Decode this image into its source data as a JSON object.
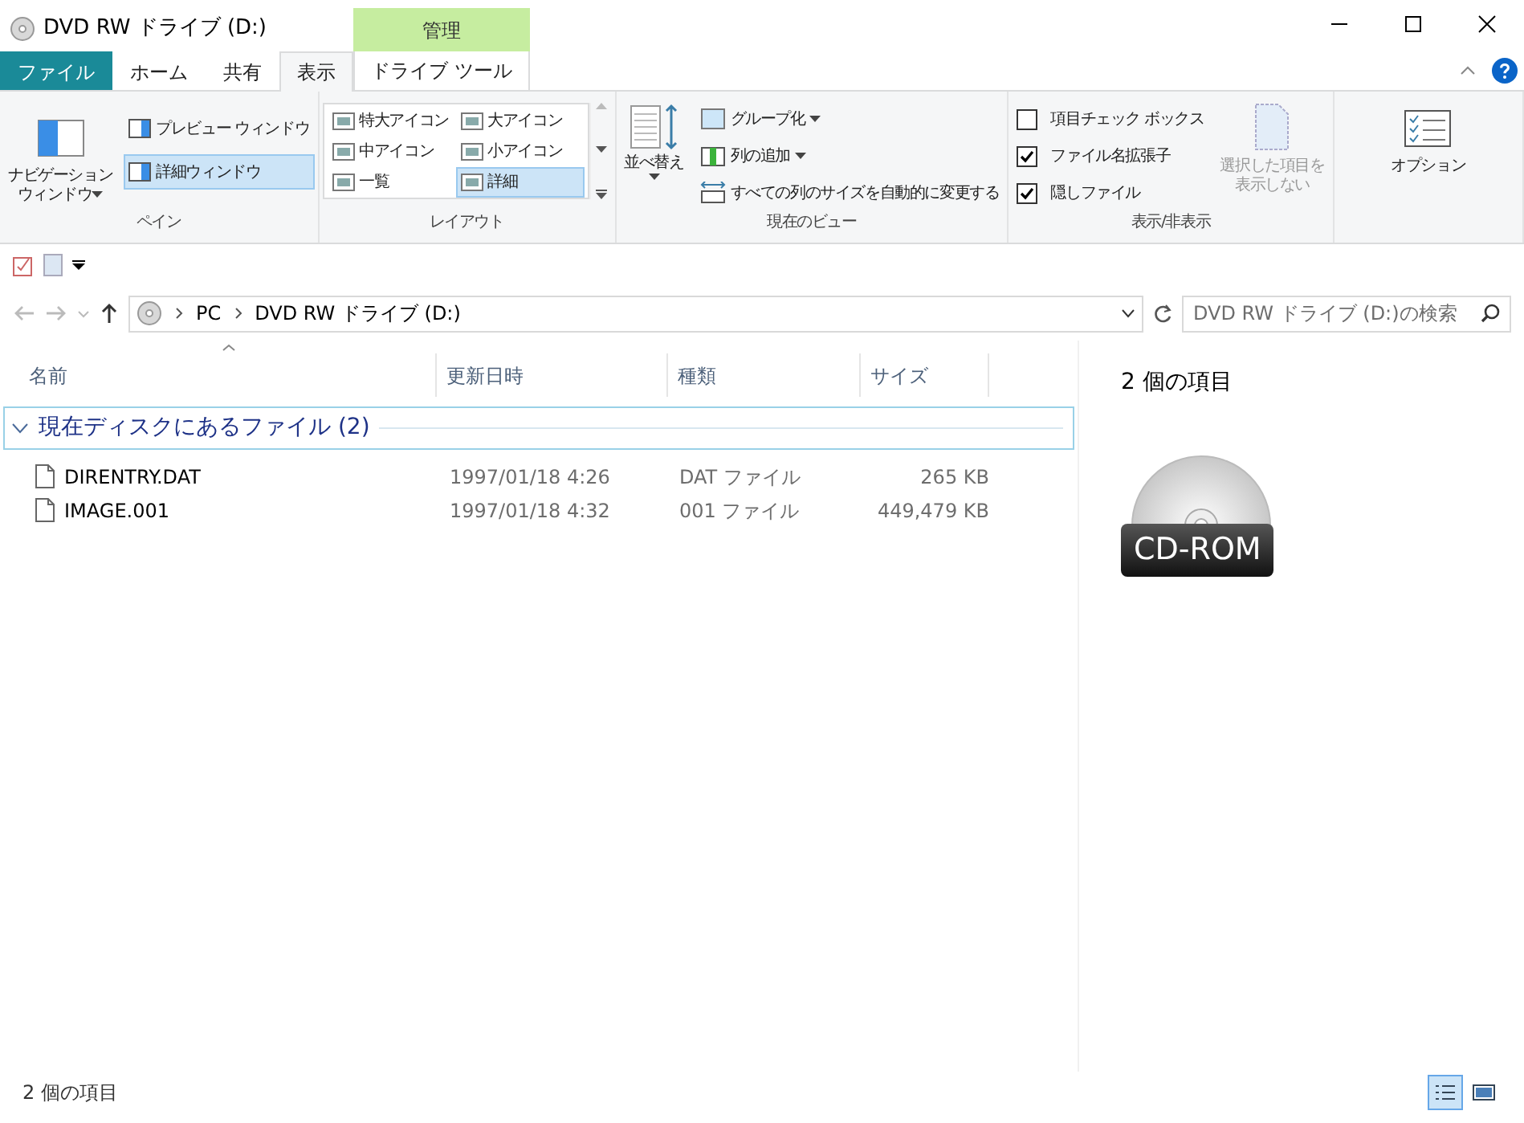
{
  "window": {
    "title": "DVD RW ドライブ (D:)"
  },
  "ribbon": {
    "context_header": "管理",
    "tabs": [
      {
        "label": "ファイル",
        "kind": "file",
        "selected": false
      },
      {
        "label": "ホーム",
        "kind": "normal",
        "selected": false
      },
      {
        "label": "共有",
        "kind": "normal",
        "selected": false
      },
      {
        "label": "表示",
        "kind": "normal",
        "selected": true
      },
      {
        "label": "ドライブ ツール",
        "kind": "context",
        "selected": false
      }
    ],
    "pane": {
      "label": "ペイン",
      "nav_button": {
        "lines": [
          "ナビゲーション",
          "ウィンドウ"
        ]
      },
      "toggles": [
        {
          "label": "プレビュー ウィンドウ",
          "selected": false
        },
        {
          "label": "詳細ウィンドウ",
          "selected": true
        }
      ]
    },
    "layout": {
      "label": "レイアウト",
      "options": [
        {
          "label": "特大アイコン",
          "selected": false
        },
        {
          "label": "大アイコン",
          "selected": false
        },
        {
          "label": "中アイコン",
          "selected": false
        },
        {
          "label": "小アイコン",
          "selected": false
        },
        {
          "label": "一覧",
          "selected": false
        },
        {
          "label": "詳細",
          "selected": true
        }
      ]
    },
    "current_view": {
      "label": "現在のビュー",
      "sort": {
        "label": "並べ替え"
      },
      "items": [
        {
          "label": "グループ化",
          "dropdown": true
        },
        {
          "label": "列の追加",
          "dropdown": true
        },
        {
          "label": "すべての列のサイズを自動的に変更する",
          "dropdown": false
        }
      ]
    },
    "show_hide": {
      "label": "表示/非表示",
      "checkboxes": [
        {
          "label": "項目チェック ボックス",
          "checked": false
        },
        {
          "label": "ファイル名拡張子",
          "checked": true
        },
        {
          "label": "隠しファイル",
          "checked": true
        }
      ],
      "hide_selected": {
        "lines": [
          "選択した項目を",
          "表示しない"
        ],
        "disabled": true
      }
    },
    "options_button": {
      "label": "オプション"
    }
  },
  "address": {
    "breadcrumb": [
      "PC",
      "DVD RW ドライブ (D:)"
    ],
    "search_placeholder": "DVD RW ドライブ (D:)の検索"
  },
  "table": {
    "columns": [
      "名前",
      "更新日時",
      "種類",
      "サイズ"
    ],
    "group": {
      "label": "現在ディスクにあるファイル (2)",
      "expanded": true
    },
    "rows": [
      {
        "name": "DIRENTRY.DAT",
        "date": "1997/01/18 4:26",
        "type": "DAT ファイル",
        "size": "265 KB"
      },
      {
        "name": "IMAGE.001",
        "date": "1997/01/18 4:32",
        "type": "001 ファイル",
        "size": "449,479 KB"
      }
    ]
  },
  "details_pane": {
    "count": "2 個の項目",
    "badge": "CD-ROM"
  },
  "status_bar": {
    "count": "2 個の項目",
    "views": [
      {
        "kind": "details",
        "selected": true
      },
      {
        "kind": "large",
        "selected": false
      }
    ]
  }
}
